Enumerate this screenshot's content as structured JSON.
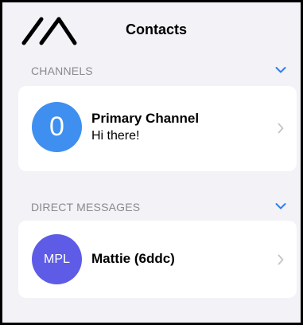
{
  "header": {
    "title": "Contacts",
    "logo_icon": "meshtastic-logo-icon"
  },
  "sections": [
    {
      "label": "CHANNELS",
      "collapse_icon": "chevron-down-icon",
      "items": [
        {
          "avatar_text": "0",
          "avatar_color": "#3f8ff0",
          "name": "Primary Channel",
          "subtitle": "Hi there!",
          "disclosure_icon": "chevron-right-icon"
        }
      ]
    },
    {
      "label": "DIRECT MESSAGES",
      "collapse_icon": "chevron-down-icon",
      "items": [
        {
          "avatar_text": "MPL",
          "avatar_color": "#5e5ce6",
          "name": "Mattie (6ddc)",
          "disclosure_icon": "chevron-right-icon"
        }
      ]
    }
  ],
  "colors": {
    "accent": "#2f80ed",
    "background": "#f2f2f7",
    "section_label": "#8a8a8e",
    "card": "#ffffff",
    "chevron_gray": "#c4c4c7"
  }
}
